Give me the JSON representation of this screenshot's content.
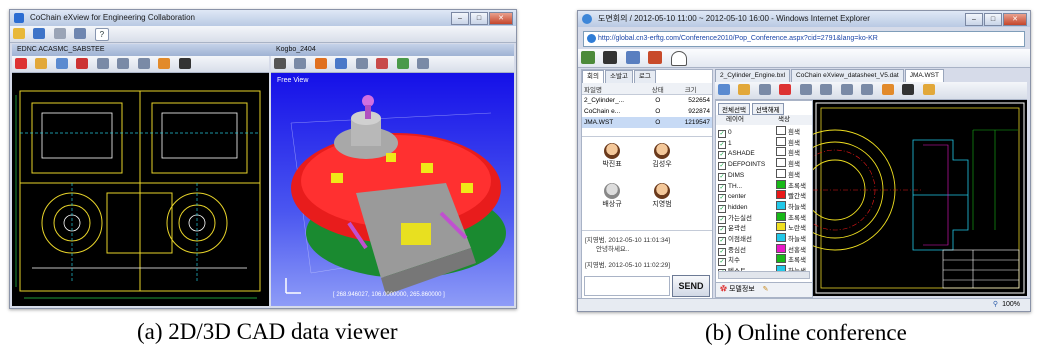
{
  "figure_a": {
    "caption": "(a) 2D/3D CAD data viewer",
    "window_title": "CoChain eXview for Engineering Collaboration",
    "toolbar_help": "?",
    "pane_2d_title": "EDNC ACASMC_SABSTEE",
    "pane_3d_title": "Kogbo_2404",
    "view_label": "Free View",
    "status_coords": "[ 268.946027, 106.0000000, 265.860000 ]"
  },
  "figure_b": {
    "caption": "(b) Online conference",
    "window_title": "도면회의 / 2012-05-10 11:00 ~ 2012-05-10 16:00 - Windows Internet Explorer",
    "address": "http://global.cn3-erftg.com/Conference2010/Pop_Conference.aspx?cid=2791&lang=ko-KR",
    "left_tabs": [
      "회의",
      "소발고",
      "로그"
    ],
    "file_table": {
      "headers": [
        "파일명",
        "상태",
        "크기"
      ],
      "rows": [
        {
          "name": "2_Cylinder_...",
          "status": "O",
          "size": "522654"
        },
        {
          "name": "CoChain e...",
          "status": "O",
          "size": "922874"
        },
        {
          "name": "JMA.WST",
          "status": "O",
          "size": "1219547"
        }
      ]
    },
    "participants": [
      "박진표",
      "김성우",
      "배상규",
      "지영범"
    ],
    "chat": [
      {
        "meta": "[지영범, 2012-05-10 11:01:34]",
        "text": "안녕하세요.."
      },
      {
        "meta": "[지영범, 2012-05-10 11:02:29]",
        "text": ""
      }
    ],
    "send_label": "SEND",
    "doc_tabs": [
      "2_Cylinder_Engine.bxl",
      "CoChain eXview_datasheet_V5.dat",
      "JMA.WST"
    ],
    "layer_buttons": [
      "전체선택",
      "선택해제"
    ],
    "layer_headers": [
      "레이어",
      "색상"
    ],
    "layers": [
      {
        "name": "0",
        "color": "흰색",
        "hex": "#ffffff"
      },
      {
        "name": "1",
        "color": "흰색",
        "hex": "#ffffff"
      },
      {
        "name": "ASHADE",
        "color": "흰색",
        "hex": "#ffffff"
      },
      {
        "name": "DEFPOINTS",
        "color": "흰색",
        "hex": "#ffffff"
      },
      {
        "name": "DIMS",
        "color": "흰색",
        "hex": "#ffffff"
      },
      {
        "name": "TH...",
        "color": "초록색",
        "hex": "#18b818"
      },
      {
        "name": "center",
        "color": "빨간색",
        "hex": "#e81818"
      },
      {
        "name": "hidden",
        "color": "하늘색",
        "hex": "#22c8e8"
      },
      {
        "name": "가는실선",
        "color": "초록색",
        "hex": "#18b818"
      },
      {
        "name": "윤곽선",
        "color": "노란색",
        "hex": "#f0e020"
      },
      {
        "name": "이점쇄선",
        "color": "하늘색",
        "hex": "#22c8e8"
      },
      {
        "name": "중심선",
        "color": "선홍색",
        "hex": "#e818c8"
      },
      {
        "name": "치수",
        "color": "초록색",
        "hex": "#18b818"
      },
      {
        "name": "텍스트",
        "color": "하늘색",
        "hex": "#22c8e8"
      }
    ],
    "bottom_tab": "모델정보",
    "zoom": "100%"
  }
}
